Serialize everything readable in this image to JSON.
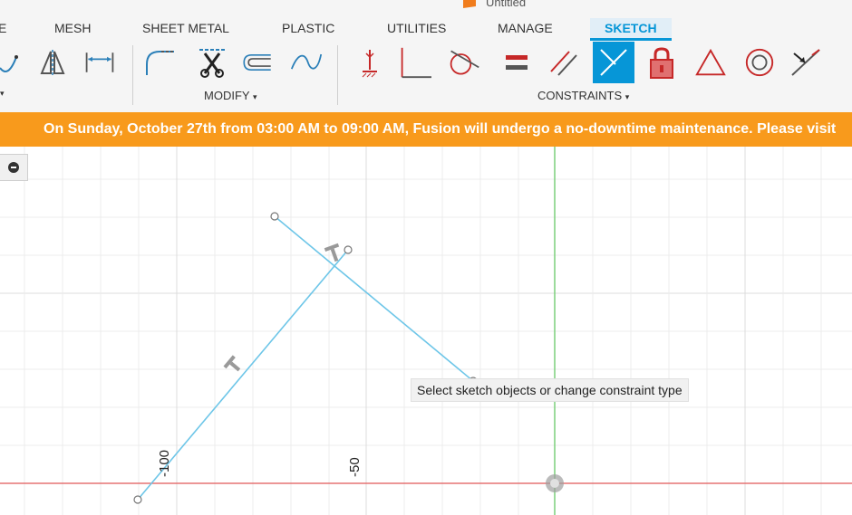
{
  "window": {
    "title": "Untitled"
  },
  "tabs": [
    {
      "label": "E"
    },
    {
      "label": "MESH"
    },
    {
      "label": "SHEET METAL"
    },
    {
      "label": "PLASTIC"
    },
    {
      "label": "UTILITIES"
    },
    {
      "label": "MANAGE"
    },
    {
      "label": "SKETCH",
      "active": true
    }
  ],
  "toolbar": {
    "groups": [
      {
        "label": "MODIFY"
      },
      {
        "label": "CONSTRAINTS"
      }
    ],
    "dropdown_caret": "▾",
    "tools": [
      {
        "name": "spline-icon"
      },
      {
        "name": "mirror-icon"
      },
      {
        "name": "dimension-icon"
      },
      {
        "name": "fillet-icon"
      },
      {
        "name": "trim-icon"
      },
      {
        "name": "offset-icon"
      },
      {
        "name": "curve-icon"
      },
      {
        "name": "fix-icon"
      },
      {
        "name": "perpendicular-icon"
      },
      {
        "name": "tangent-icon"
      },
      {
        "name": "equal-icon"
      },
      {
        "name": "parallel-icon"
      },
      {
        "name": "perpendicular-constraint-icon",
        "selected": true
      },
      {
        "name": "lock-icon"
      },
      {
        "name": "triangle-icon"
      },
      {
        "name": "concentric-icon"
      },
      {
        "name": "midpoint-icon"
      }
    ]
  },
  "banner": {
    "text": "On Sunday, October 27th from 03:00 AM to 09:00 AM, Fusion will undergo a no-downtime maintenance. Please visit",
    "color": "#f89a1c"
  },
  "canvas": {
    "tooltip": "Select sketch objects or change constraint type",
    "axis_labels": [
      "-100",
      "-50"
    ],
    "line_color": "#6ec6e8",
    "x_axis_color": "#e57373",
    "y_axis_color": "#7ccf7c"
  }
}
